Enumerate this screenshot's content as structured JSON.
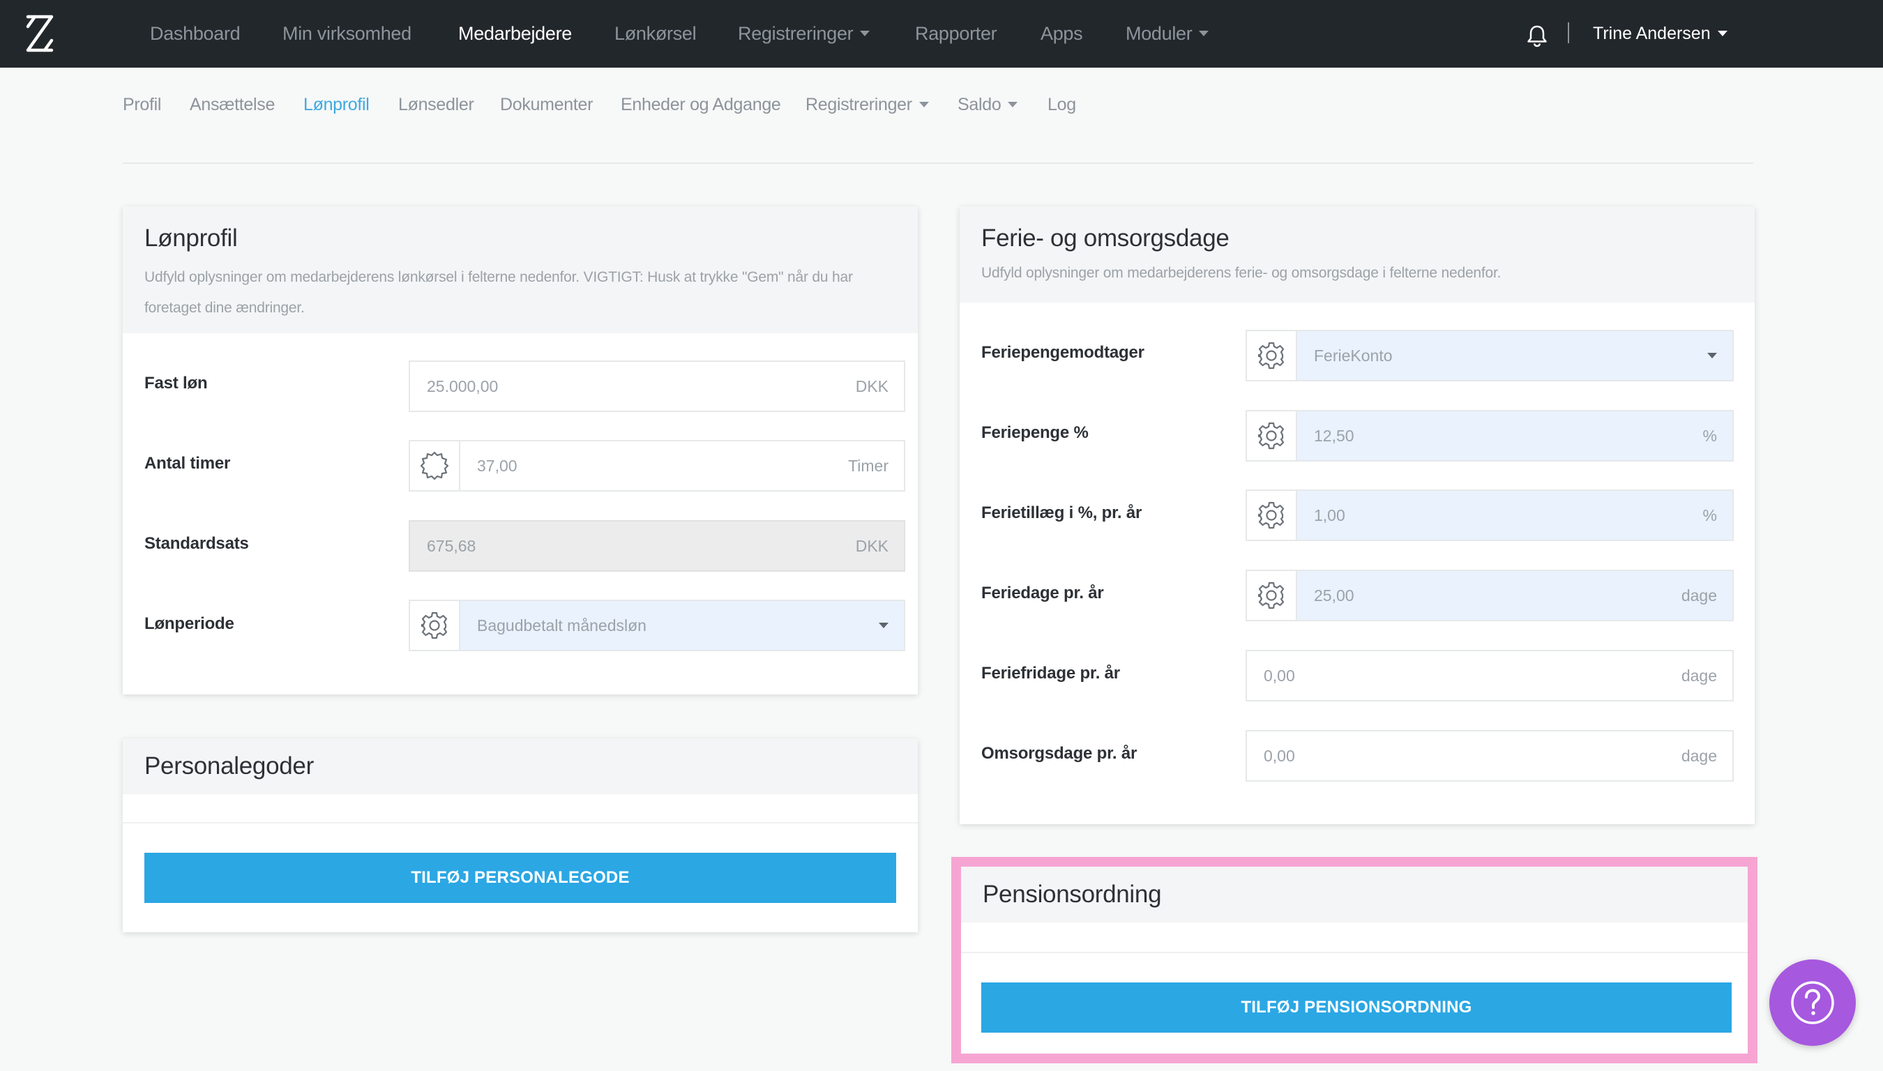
{
  "topnav": {
    "items": [
      {
        "label": "Dashboard"
      },
      {
        "label": "Min virksomhed"
      },
      {
        "label": "Medarbejdere"
      },
      {
        "label": "Lønkørsel"
      },
      {
        "label": "Registreringer"
      },
      {
        "label": "Rapporter"
      },
      {
        "label": "Apps"
      },
      {
        "label": "Moduler"
      }
    ],
    "active": "Medarbejdere",
    "user_name": "Trine Andersen"
  },
  "subnav": {
    "items": [
      {
        "label": "Profil"
      },
      {
        "label": "Ansættelse"
      },
      {
        "label": "Lønprofil"
      },
      {
        "label": "Lønsedler"
      },
      {
        "label": "Dokumenter"
      },
      {
        "label": "Enheder og Adgange"
      },
      {
        "label": "Registreringer"
      },
      {
        "label": "Saldo"
      },
      {
        "label": "Log"
      }
    ],
    "active": "Lønprofil"
  },
  "lonprofil": {
    "title": "Lønprofil",
    "description": "Udfyld oplysninger om medarbejderens lønkørsel i felterne nedenfor. VIGTIGT: Husk at trykke \"Gem\" når du har foretaget dine ændringer.",
    "fields": [
      {
        "label": "Fast løn",
        "value": "25.000,00",
        "unit": "DKK"
      },
      {
        "label": "Antal timer",
        "value": "37,00",
        "unit": "Timer",
        "icon": "gear-outline-icon"
      },
      {
        "label": "Standardsats",
        "value": "675,68",
        "unit": "DKK"
      },
      {
        "label": "Lønperiode",
        "value": "Bagudbetalt månedsløn",
        "icon": "gear-icon"
      }
    ]
  },
  "personalegoder": {
    "title": "Personalegoder",
    "button": "TILFØJ PERSONALEGODE"
  },
  "ferie": {
    "title": "Ferie- og omsorgsdage",
    "description": "Udfyld oplysninger om medarbejderens ferie- og omsorgsdage i felterne nedenfor.",
    "fields": [
      {
        "label": "Feriepengemodtager",
        "value": "FerieKonto",
        "icon": "gear-icon"
      },
      {
        "label": "Feriepenge %",
        "value": "12,50",
        "unit": "%",
        "icon": "gear-icon"
      },
      {
        "label": "Ferietillæg i %, pr. år",
        "value": "1,00",
        "unit": "%",
        "icon": "gear-icon"
      },
      {
        "label": "Feriedage pr. år",
        "value": "25,00",
        "unit": "dage",
        "icon": "gear-icon"
      },
      {
        "label": "Feriefridage pr. år",
        "value": "0,00",
        "unit": "dage"
      },
      {
        "label": "Omsorgsdage pr. år",
        "value": "0,00",
        "unit": "dage"
      }
    ]
  },
  "pension": {
    "title": "Pensionsordning",
    "button": "TILFØJ PENSIONSORDNING"
  },
  "colors": {
    "navbar": "#22272c",
    "accent": "#2ba7e4",
    "active_tab": "#3fa9e0",
    "highlight": "#f6a5d3",
    "help": "#a658df"
  }
}
